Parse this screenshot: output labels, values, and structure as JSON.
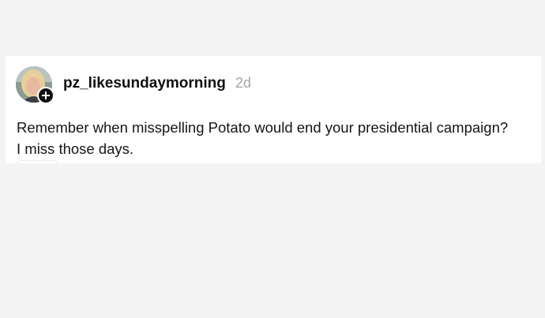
{
  "post": {
    "username": "pz_likesundaymorning",
    "timestamp": "2d",
    "text_lines": [
      "Remember when misspelling Potato would end your presidential campaign?",
      "I miss those days."
    ],
    "avatar_icon": "profile-photo",
    "follow_icon": "plus-icon"
  },
  "colors": {
    "page_bg": "#f4f4f4",
    "card_bg": "#ffffff",
    "text_primary": "#151515",
    "text_muted": "#a5a5a5",
    "badge": "#111111"
  }
}
